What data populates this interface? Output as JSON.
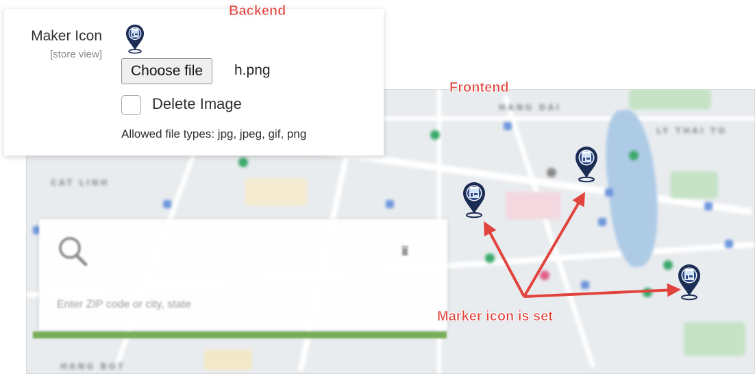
{
  "annotations": {
    "backend": "Backend",
    "frontend": "Frontend",
    "marker_note": "Marker icon is set"
  },
  "backend": {
    "field_label": "Maker Icon",
    "field_scope": "[store view]",
    "choose_file_label": "Choose file",
    "file_name": "h.png",
    "delete_label": "Delete Image",
    "allowed_types": "Allowed file types: jpg, jpeg, gif, png",
    "preview_icon": "store-map-marker-icon"
  },
  "frontend": {
    "map_labels": [
      "HANG DAI",
      "CAT LINH",
      "LY THAI TO",
      "HANG BOT"
    ],
    "search_placeholder": "Enter ZIP code or city, state",
    "search_icon": "magnifier-icon",
    "clear_icon": "trash-icon",
    "marker_icon": "store-map-marker-icon"
  },
  "colors": {
    "callout": "#e0443c",
    "marker_navy": "#1b2c55",
    "marker_light": "#cfe3f7",
    "map_green_bar": "#77ad58"
  }
}
